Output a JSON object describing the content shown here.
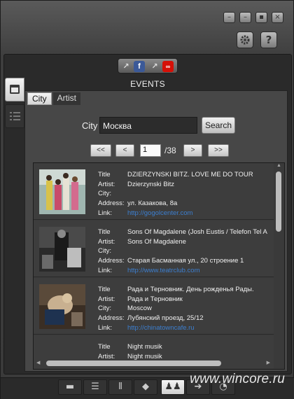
{
  "window": {
    "controls": [
      "minimize-icon",
      "restore-icon",
      "maximize-icon",
      "close-icon"
    ],
    "toolbar": [
      "gear-icon",
      "help-icon"
    ],
    "help_symbol": "?",
    "close_symbol": "×"
  },
  "share": [
    "external-link-icon",
    "facebook-icon",
    "external-link-icon",
    "lastfm-icon"
  ],
  "header": {
    "title": "EVENTS"
  },
  "subtabs": [
    {
      "label": "City",
      "active": true
    },
    {
      "label": "Artist",
      "active": false
    }
  ],
  "search": {
    "label": "City",
    "value": "Москва",
    "button": "Search"
  },
  "pager": {
    "first": "<<",
    "prev": "<",
    "page": "1",
    "total": "/38",
    "next": ">",
    "last": ">>"
  },
  "field_labels": {
    "title": "Title",
    "artist": "Artist:",
    "city": "City:",
    "address": "Address:",
    "link": "Link:"
  },
  "events": [
    {
      "title": "DZIERZYNSKI BITZ. LOVE ME DO TOUR",
      "artist": "Dzierzynski Bitz",
      "city": "",
      "address": "ул. Казакова, 8а",
      "link": "http://gogolcenter.com"
    },
    {
      "title": "Sons Of Magdalene (Josh Eustis / Telefon Tel A",
      "artist": "Sons Of Magdalene",
      "city": "",
      "address": "Старая Басманная ул., 20 строение 1",
      "link": "http://www.teatrclub.com"
    },
    {
      "title": "Рада и Терновник. День рожденья Рады.",
      "artist": "Рада и Терновник",
      "city": "Moscow",
      "address": "Лубянский проезд, 25/12",
      "link": "http://chinatowncafe.ru"
    },
    {
      "title": "Night musik",
      "artist": "Night musik",
      "city": "",
      "address": "",
      "link": ""
    }
  ],
  "bottom_bar": [
    "monitor-icon",
    "list-icon",
    "equalizer-icon",
    "tag-icon",
    "people-icon",
    "export-icon",
    "rss-icon"
  ],
  "watermark": "www.wincore.ru",
  "colors": {
    "link": "#3c7fd0",
    "facebook": "#3b5998",
    "lastfm": "#d51007"
  }
}
